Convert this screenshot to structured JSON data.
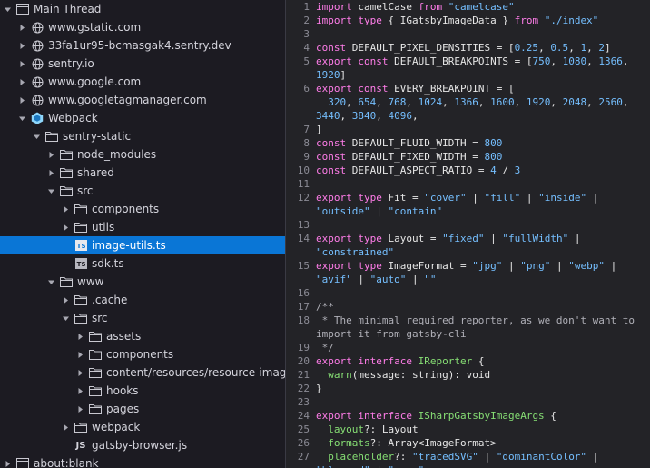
{
  "tree": {
    "rows": [
      {
        "label": "Main Thread",
        "depth": 0,
        "twisty": "open",
        "icon": "window-icon",
        "type": "thread"
      },
      {
        "label": "www.gstatic.com",
        "depth": 1,
        "twisty": "closed",
        "icon": "globe-icon",
        "type": "domain"
      },
      {
        "label": "33fa1ur95-bcmasgak4.sentry.dev",
        "depth": 1,
        "twisty": "closed",
        "icon": "globe-icon",
        "type": "domain"
      },
      {
        "label": "sentry.io",
        "depth": 1,
        "twisty": "closed",
        "icon": "globe-icon",
        "type": "domain"
      },
      {
        "label": "www.google.com",
        "depth": 1,
        "twisty": "closed",
        "icon": "globe-icon",
        "type": "domain"
      },
      {
        "label": "www.googletagmanager.com",
        "depth": 1,
        "twisty": "closed",
        "icon": "globe-icon",
        "type": "domain"
      },
      {
        "label": "Webpack",
        "depth": 1,
        "twisty": "open",
        "icon": "webpack-icon",
        "type": "webpack"
      },
      {
        "label": "sentry-static",
        "depth": 2,
        "twisty": "open",
        "icon": "folder-icon",
        "type": "folder"
      },
      {
        "label": "node_modules",
        "depth": 3,
        "twisty": "closed",
        "icon": "folder-icon",
        "type": "folder"
      },
      {
        "label": "shared",
        "depth": 3,
        "twisty": "closed",
        "icon": "folder-icon",
        "type": "folder"
      },
      {
        "label": "src",
        "depth": 3,
        "twisty": "open",
        "icon": "folder-icon",
        "type": "folder"
      },
      {
        "label": "components",
        "depth": 4,
        "twisty": "closed",
        "icon": "folder-icon",
        "type": "folder"
      },
      {
        "label": "utils",
        "depth": 4,
        "twisty": "closed",
        "icon": "folder-icon",
        "type": "folder"
      },
      {
        "label": "image-utils.ts",
        "depth": 4,
        "twisty": "none",
        "icon": "typescript-file-icon",
        "type": "ts",
        "selected": true
      },
      {
        "label": "sdk.ts",
        "depth": 4,
        "twisty": "none",
        "icon": "typescript-file-icon",
        "type": "ts"
      },
      {
        "label": "www",
        "depth": 3,
        "twisty": "open",
        "icon": "folder-icon",
        "type": "folder"
      },
      {
        "label": ".cache",
        "depth": 4,
        "twisty": "closed",
        "icon": "folder-icon",
        "type": "folder"
      },
      {
        "label": "src",
        "depth": 4,
        "twisty": "open",
        "icon": "folder-icon",
        "type": "folder"
      },
      {
        "label": "assets",
        "depth": 5,
        "twisty": "closed",
        "icon": "folder-icon",
        "type": "folder"
      },
      {
        "label": "components",
        "depth": 5,
        "twisty": "closed",
        "icon": "folder-icon",
        "type": "folder"
      },
      {
        "label": "content/resources/resource-images/js-fr",
        "depth": 5,
        "twisty": "closed",
        "icon": "folder-icon",
        "type": "folder"
      },
      {
        "label": "hooks",
        "depth": 5,
        "twisty": "closed",
        "icon": "folder-icon",
        "type": "folder"
      },
      {
        "label": "pages",
        "depth": 5,
        "twisty": "closed",
        "icon": "folder-icon",
        "type": "folder"
      },
      {
        "label": "webpack",
        "depth": 4,
        "twisty": "closed",
        "icon": "folder-icon",
        "type": "folder"
      },
      {
        "label": "gatsby-browser.js",
        "depth": 4,
        "twisty": "none",
        "icon": "javascript-file-icon",
        "type": "js"
      },
      {
        "label": "about:blank",
        "depth": 0,
        "twisty": "closed",
        "icon": "window-icon",
        "type": "thread"
      }
    ],
    "ts_badge": "TS",
    "js_badge": "JS"
  },
  "editor": {
    "colors": {
      "keyword": "#ff7de9",
      "string": "#75bfff",
      "type": "#86de74",
      "comment": "#b0b0b8",
      "text": "#e6e6e6"
    },
    "lines": [
      {
        "n": "1",
        "rows": [
          [
            [
              "kw",
              "import"
            ],
            [
              "plain",
              " camelCase "
            ],
            [
              "kw",
              "from"
            ],
            [
              "plain",
              " "
            ],
            [
              "str",
              "\"camelcase\""
            ]
          ]
        ]
      },
      {
        "n": "2",
        "rows": [
          [
            [
              "kw",
              "import"
            ],
            [
              "plain",
              " "
            ],
            [
              "kw",
              "type"
            ],
            [
              "plain",
              " { IGatsbyImageData } "
            ],
            [
              "kw",
              "from"
            ],
            [
              "plain",
              " "
            ],
            [
              "str",
              "\"./index\""
            ]
          ]
        ]
      },
      {
        "n": "3",
        "rows": [
          []
        ]
      },
      {
        "n": "4",
        "rows": [
          [
            [
              "kw",
              "const"
            ],
            [
              "plain",
              " DEFAULT_PIXEL_DENSITIES = ["
            ],
            [
              "num",
              "0.25"
            ],
            [
              "plain",
              ", "
            ],
            [
              "num",
              "0.5"
            ],
            [
              "plain",
              ", "
            ],
            [
              "num",
              "1"
            ],
            [
              "plain",
              ", "
            ],
            [
              "num",
              "2"
            ],
            [
              "plain",
              "]"
            ]
          ]
        ]
      },
      {
        "n": "5",
        "rows": [
          [
            [
              "kw",
              "export"
            ],
            [
              "plain",
              " "
            ],
            [
              "kw",
              "const"
            ],
            [
              "plain",
              " DEFAULT_BREAKPOINTS = ["
            ],
            [
              "num",
              "750"
            ],
            [
              "plain",
              ", "
            ],
            [
              "num",
              "1080"
            ],
            [
              "plain",
              ", "
            ],
            [
              "num",
              "1366"
            ],
            [
              "plain",
              ","
            ]
          ],
          [
            [
              "num",
              "1920"
            ],
            [
              "plain",
              "]"
            ]
          ]
        ]
      },
      {
        "n": "6",
        "rows": [
          [
            [
              "kw",
              "export"
            ],
            [
              "plain",
              " "
            ],
            [
              "kw",
              "const"
            ],
            [
              "plain",
              " EVERY_BREAKPOINT = ["
            ]
          ],
          [
            [
              "plain",
              "  "
            ],
            [
              "num",
              "320"
            ],
            [
              "plain",
              ", "
            ],
            [
              "num",
              "654"
            ],
            [
              "plain",
              ", "
            ],
            [
              "num",
              "768"
            ],
            [
              "plain",
              ", "
            ],
            [
              "num",
              "1024"
            ],
            [
              "plain",
              ", "
            ],
            [
              "num",
              "1366"
            ],
            [
              "plain",
              ", "
            ],
            [
              "num",
              "1600"
            ],
            [
              "plain",
              ", "
            ],
            [
              "num",
              "1920"
            ],
            [
              "plain",
              ", "
            ],
            [
              "num",
              "2048"
            ],
            [
              "plain",
              ", "
            ],
            [
              "num",
              "2560"
            ],
            [
              "plain",
              ","
            ]
          ],
          [
            [
              "num",
              "3440"
            ],
            [
              "plain",
              ", "
            ],
            [
              "num",
              "3840"
            ],
            [
              "plain",
              ", "
            ],
            [
              "num",
              "4096"
            ],
            [
              "plain",
              ","
            ]
          ]
        ]
      },
      {
        "n": "7",
        "rows": [
          [
            [
              "plain",
              "]"
            ]
          ]
        ]
      },
      {
        "n": "8",
        "rows": [
          [
            [
              "kw",
              "const"
            ],
            [
              "plain",
              " DEFAULT_FLUID_WIDTH = "
            ],
            [
              "num",
              "800"
            ]
          ]
        ]
      },
      {
        "n": "9",
        "rows": [
          [
            [
              "kw",
              "const"
            ],
            [
              "plain",
              " DEFAULT_FIXED_WIDTH = "
            ],
            [
              "num",
              "800"
            ]
          ]
        ]
      },
      {
        "n": "10",
        "rows": [
          [
            [
              "kw",
              "const"
            ],
            [
              "plain",
              " DEFAULT_ASPECT_RATIO = "
            ],
            [
              "num",
              "4"
            ],
            [
              "plain",
              " / "
            ],
            [
              "num",
              "3"
            ]
          ]
        ]
      },
      {
        "n": "11",
        "rows": [
          []
        ]
      },
      {
        "n": "12",
        "rows": [
          [
            [
              "kw",
              "export"
            ],
            [
              "plain",
              " "
            ],
            [
              "kw",
              "type"
            ],
            [
              "plain",
              " Fit = "
            ],
            [
              "str",
              "\"cover\""
            ],
            [
              "plain",
              " | "
            ],
            [
              "str",
              "\"fill\""
            ],
            [
              "plain",
              " | "
            ],
            [
              "str",
              "\"inside\""
            ],
            [
              "plain",
              " |"
            ]
          ],
          [
            [
              "str",
              "\"outside\""
            ],
            [
              "plain",
              " | "
            ],
            [
              "str",
              "\"contain\""
            ]
          ]
        ]
      },
      {
        "n": "13",
        "rows": [
          []
        ]
      },
      {
        "n": "14",
        "rows": [
          [
            [
              "kw",
              "export"
            ],
            [
              "plain",
              " "
            ],
            [
              "kw",
              "type"
            ],
            [
              "plain",
              " Layout = "
            ],
            [
              "str",
              "\"fixed\""
            ],
            [
              "plain",
              " | "
            ],
            [
              "str",
              "\"fullWidth\""
            ],
            [
              "plain",
              " |"
            ]
          ],
          [
            [
              "str",
              "\"constrained\""
            ]
          ]
        ]
      },
      {
        "n": "15",
        "rows": [
          [
            [
              "kw",
              "export"
            ],
            [
              "plain",
              " "
            ],
            [
              "kw",
              "type"
            ],
            [
              "plain",
              " ImageFormat = "
            ],
            [
              "str",
              "\"jpg\""
            ],
            [
              "plain",
              " | "
            ],
            [
              "str",
              "\"png\""
            ],
            [
              "plain",
              " | "
            ],
            [
              "str",
              "\"webp\""
            ],
            [
              "plain",
              " |"
            ]
          ],
          [
            [
              "str",
              "\"avif\""
            ],
            [
              "plain",
              " | "
            ],
            [
              "str",
              "\"auto\""
            ],
            [
              "plain",
              " | "
            ],
            [
              "str",
              "\"\""
            ]
          ]
        ]
      },
      {
        "n": "16",
        "rows": [
          []
        ]
      },
      {
        "n": "17",
        "rows": [
          [
            [
              "cm",
              "/**"
            ]
          ]
        ]
      },
      {
        "n": "18",
        "rows": [
          [
            [
              "cm",
              " * The minimal required reporter, as we don't want to"
            ]
          ],
          [
            [
              "cm",
              "import it from gatsby-cli"
            ]
          ]
        ]
      },
      {
        "n": "19",
        "rows": [
          [
            [
              "cm",
              " */"
            ]
          ]
        ]
      },
      {
        "n": "20",
        "rows": [
          [
            [
              "kw",
              "export"
            ],
            [
              "plain",
              " "
            ],
            [
              "kw",
              "interface"
            ],
            [
              "plain",
              " "
            ],
            [
              "typ",
              "IReporter"
            ],
            [
              "plain",
              " {"
            ]
          ]
        ]
      },
      {
        "n": "21",
        "rows": [
          [
            [
              "plain",
              "  "
            ],
            [
              "typ",
              "warn"
            ],
            [
              "plain",
              "(message: string): void"
            ]
          ]
        ]
      },
      {
        "n": "22",
        "rows": [
          [
            [
              "plain",
              "}"
            ]
          ]
        ]
      },
      {
        "n": "23",
        "rows": [
          []
        ]
      },
      {
        "n": "24",
        "rows": [
          [
            [
              "kw",
              "export"
            ],
            [
              "plain",
              " "
            ],
            [
              "kw",
              "interface"
            ],
            [
              "plain",
              " "
            ],
            [
              "typ",
              "ISharpGatsbyImageArgs"
            ],
            [
              "plain",
              " {"
            ]
          ]
        ]
      },
      {
        "n": "25",
        "rows": [
          [
            [
              "plain",
              "  "
            ],
            [
              "typ",
              "layout"
            ],
            [
              "plain",
              "?: Layout"
            ]
          ]
        ]
      },
      {
        "n": "26",
        "rows": [
          [
            [
              "plain",
              "  "
            ],
            [
              "typ",
              "formats"
            ],
            [
              "plain",
              "?: Array<ImageFormat>"
            ]
          ]
        ]
      },
      {
        "n": "27",
        "rows": [
          [
            [
              "plain",
              "  "
            ],
            [
              "typ",
              "placeholder"
            ],
            [
              "plain",
              "?: "
            ],
            [
              "str",
              "\"tracedSVG\""
            ],
            [
              "plain",
              " | "
            ],
            [
              "str",
              "\"dominantColor\""
            ],
            [
              "plain",
              " |"
            ]
          ],
          [
            [
              "str",
              "\"blurred\""
            ],
            [
              "plain",
              " | "
            ],
            [
              "str",
              "\"none\""
            ]
          ]
        ]
      }
    ]
  }
}
